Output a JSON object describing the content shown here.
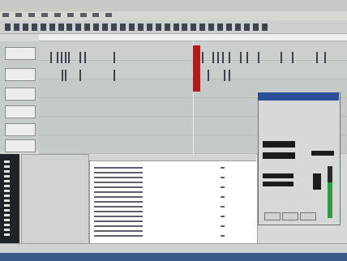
{
  "app": {
    "title": ""
  },
  "dialog": {
    "title": ""
  }
}
